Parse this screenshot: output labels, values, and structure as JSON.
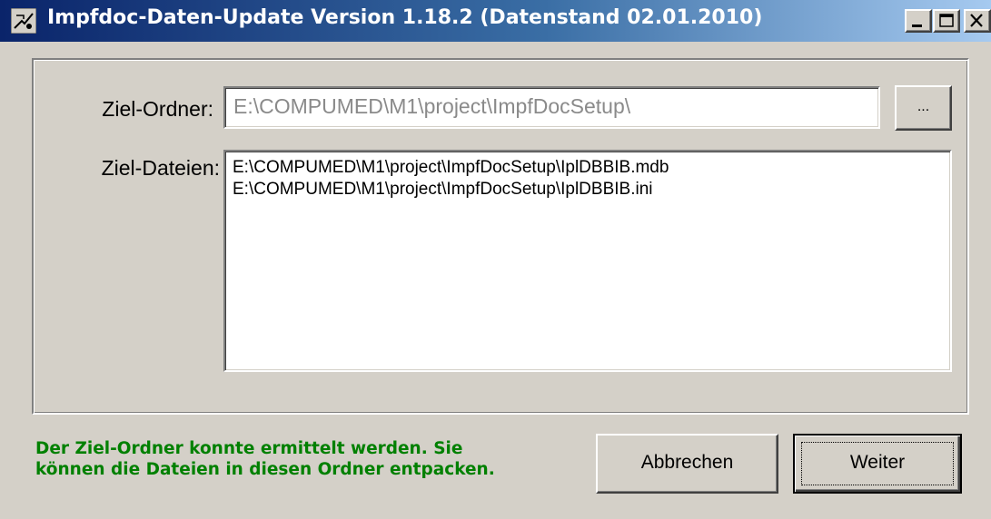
{
  "window": {
    "title": "Impfdoc-Daten-Update Version 1.18.2 (Datenstand 02.01.2010)",
    "icon": "app-icon",
    "controls": [
      "minimize-icon",
      "maximize-icon",
      "close-icon"
    ]
  },
  "form": {
    "ziel_ordner_label": "Ziel-Ordner:",
    "ziel_ordner_value": "E:\\COMPUMED\\M1\\project\\ImpfDocSetup\\",
    "browse_label": "...",
    "ziel_dateien_label": "Ziel-Dateien:",
    "ziel_dateien": [
      "E:\\COMPUMED\\M1\\project\\ImpfDocSetup\\IplDBBIB.mdb",
      "E:\\COMPUMED\\M1\\project\\ImpfDocSetup\\IplDBBIB.ini"
    ]
  },
  "status": {
    "line1": "Der Ziel-Ordner konnte ermittelt werden. Sie",
    "line2": "können die Dateien in diesen Ordner entpacken.",
    "color": "#008000"
  },
  "buttons": {
    "cancel": "Abbrechen",
    "next": "Weiter"
  }
}
